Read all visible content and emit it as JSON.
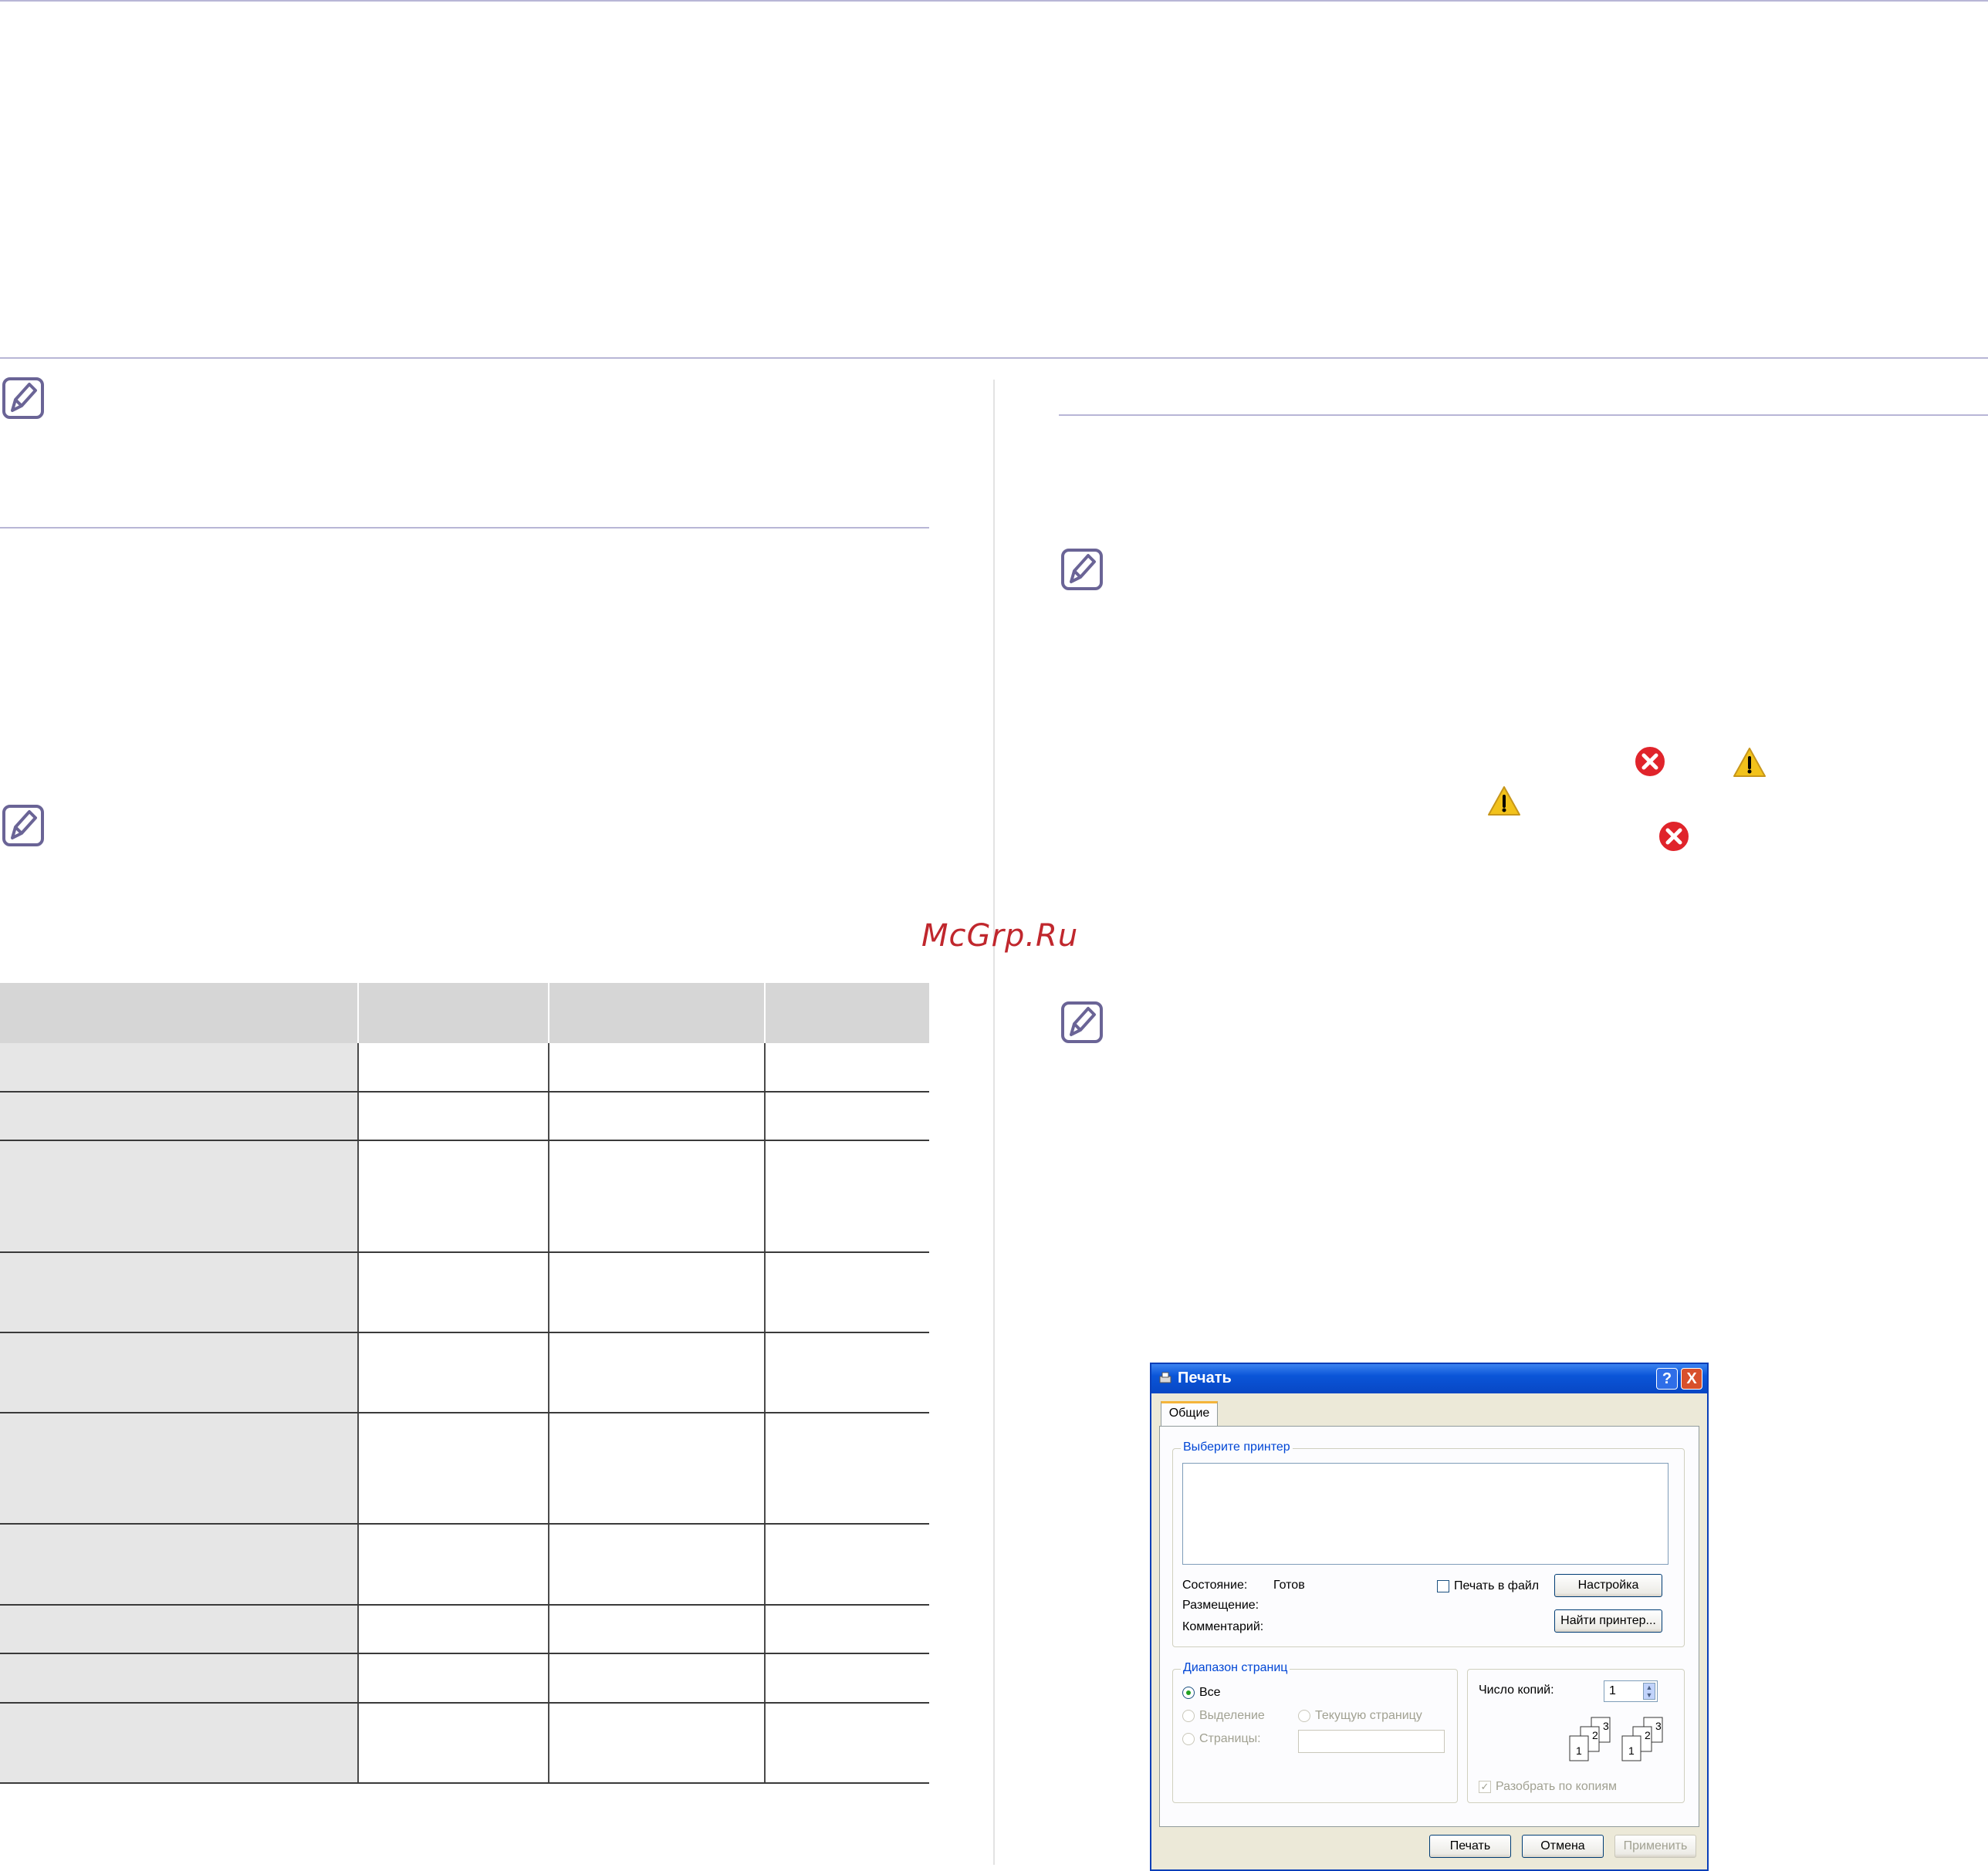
{
  "watermark": "McGrp.Ru",
  "dialog": {
    "title": "Печать",
    "help_btn": "?",
    "close_btn": "X",
    "tab_general": "Общие",
    "select_printer_legend": "Выберите принтер",
    "status_label": "Состояние:",
    "status_value": "Готов",
    "location_label": "Размещение:",
    "comment_label": "Комментарий:",
    "print_to_file": "Печать в файл",
    "setup_btn": "Настройка",
    "find_printer_btn": "Найти принтер...",
    "page_range_legend": "Диапазон страниц",
    "range_all": "Все",
    "range_selection": "Выделение",
    "range_current": "Текущую страницу",
    "range_pages": "Страницы:",
    "copies_label": "Число копий:",
    "copies_value": "1",
    "collate": "Разобрать по копиям",
    "collate_pages": [
      "1",
      "2",
      "3"
    ],
    "print_btn": "Печать",
    "cancel_btn": "Отмена",
    "apply_btn": "Применить"
  },
  "colors": {
    "rule": "#b8b6d6",
    "note_icon": "#6a6496",
    "watermark": "#c0272d",
    "error": "#e0242b",
    "warning": "#f2c21b"
  }
}
